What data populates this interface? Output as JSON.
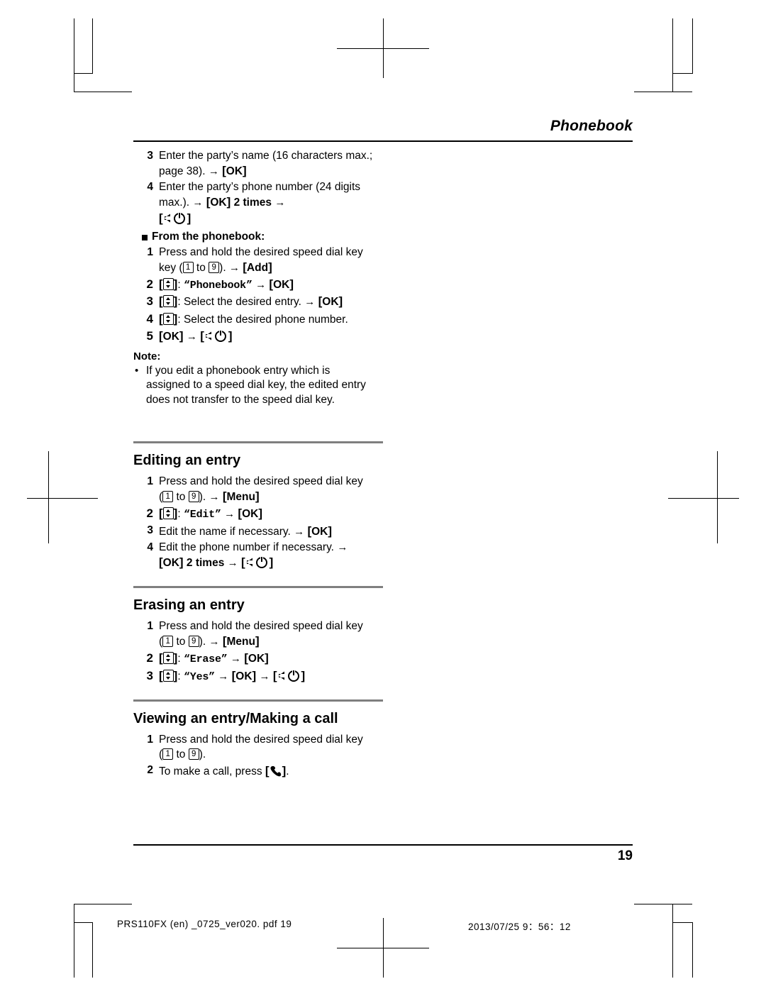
{
  "header": {
    "title": "Phonebook"
  },
  "sections": {
    "intro_steps": [
      {
        "num": "3",
        "text": "Enter the party’s name (16 characters max.; page 38). "
      },
      {
        "num": "4",
        "text": "Enter the party’s phone number (24 digits max.). "
      }
    ],
    "from_phonebook": {
      "label": "From the phonebook:",
      "steps": [
        {
          "num": "1",
          "text": "Press and hold the desired speed dial key"
        },
        {
          "num": "2",
          "text": "“Phonebook”"
        },
        {
          "num": "3",
          "text": "Select the desired entry."
        },
        {
          "num": "4",
          "text": "Select the desired phone number."
        },
        {
          "num": "5",
          "text": ""
        }
      ]
    },
    "note": {
      "label": "Note:",
      "items": [
        "If you edit a phonebook entry which is assigned to a speed dial key, the edited entry does not transfer to the speed dial key."
      ]
    },
    "editing": {
      "title": "Editing an entry",
      "steps": [
        {
          "num": "1",
          "text": "Press and hold the desired speed dial key"
        },
        {
          "num": "2",
          "text": "“Edit”"
        },
        {
          "num": "3",
          "text": "Edit the name if necessary. "
        },
        {
          "num": "4",
          "text": "Edit the phone number if necessary. "
        }
      ]
    },
    "erasing": {
      "title": "Erasing an entry",
      "steps": [
        {
          "num": "1",
          "text": "Press and hold the desired speed dial key"
        },
        {
          "num": "2",
          "text": "“Erase”"
        },
        {
          "num": "3",
          "text": "“Yes”"
        }
      ]
    },
    "viewing": {
      "title": "Viewing an entry/Making a call",
      "steps": [
        {
          "num": "1",
          "text": "Press and hold the desired speed dial key"
        },
        {
          "num": "2",
          "text": "To make a call, press "
        }
      ]
    }
  },
  "keys": {
    "ok": "OK",
    "add": "Add",
    "menu": "Menu",
    "two_times": "2 times",
    "to": "to",
    "key1": "1",
    "key9": "9",
    "bracket_open": "[",
    "bracket_close": "]",
    "arrow": "→"
  },
  "footer": {
    "page_number": "19",
    "file_info": "PRS110FX (en) _0725_ver020. pdf    19",
    "timestamp": "2013/07/25    9：56：12"
  }
}
